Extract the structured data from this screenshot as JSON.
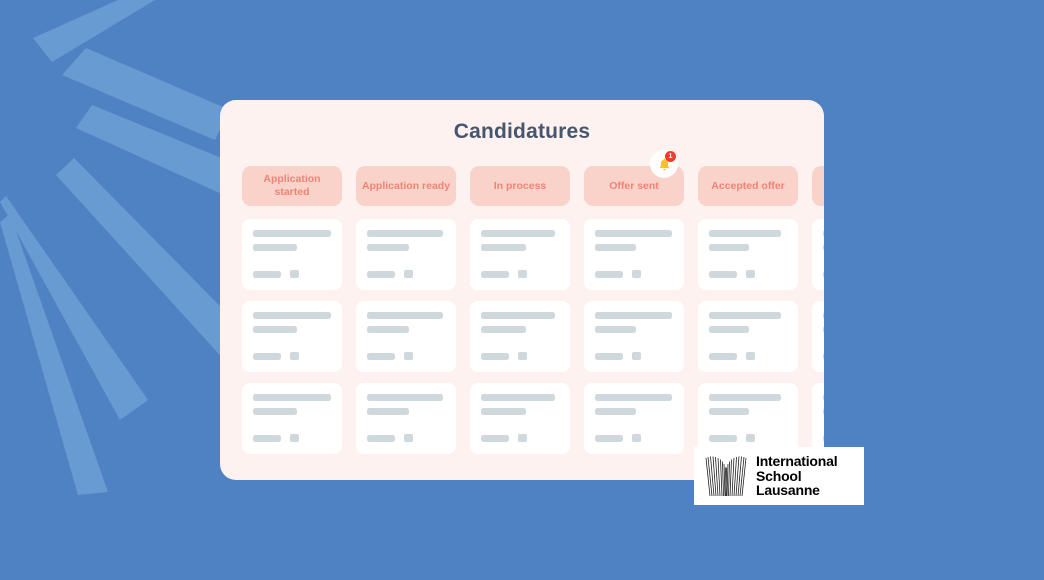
{
  "background": {
    "color": "#4F82C2",
    "ray_color": "#679BD2",
    "ray_count": 6
  },
  "panel": {
    "title": "Candidatures",
    "background": "#FDF2F0",
    "title_color": "#47566F"
  },
  "board": {
    "pill_background": "#F9D2CA",
    "pill_text_color": "#EE8476",
    "card_background": "#FFFFFF",
    "skeleton_color": "#CFD8DD",
    "rows": 3,
    "columns": [
      {
        "label": "Application started",
        "line1": 78,
        "line2": 44
      },
      {
        "label": "Application ready",
        "line1": 76,
        "line2": 42
      },
      {
        "label": "In process",
        "line1": 74,
        "line2": 45
      },
      {
        "label": "Offer sent",
        "line1": 77,
        "line2": 41
      },
      {
        "label": "Accepted offer",
        "line1": 72,
        "line2": 40
      },
      {
        "label": "",
        "line1": 70,
        "line2": 40
      }
    ]
  },
  "notification": {
    "icon": "bell-icon",
    "count": "1",
    "badge_color": "#EE3B30",
    "bell_color": "#FBC02D",
    "attached_to": "Offer sent"
  },
  "logo": {
    "line1": "International",
    "line2": "School",
    "line3": "Lausanne",
    "mark": "radiating-fan-icon"
  }
}
